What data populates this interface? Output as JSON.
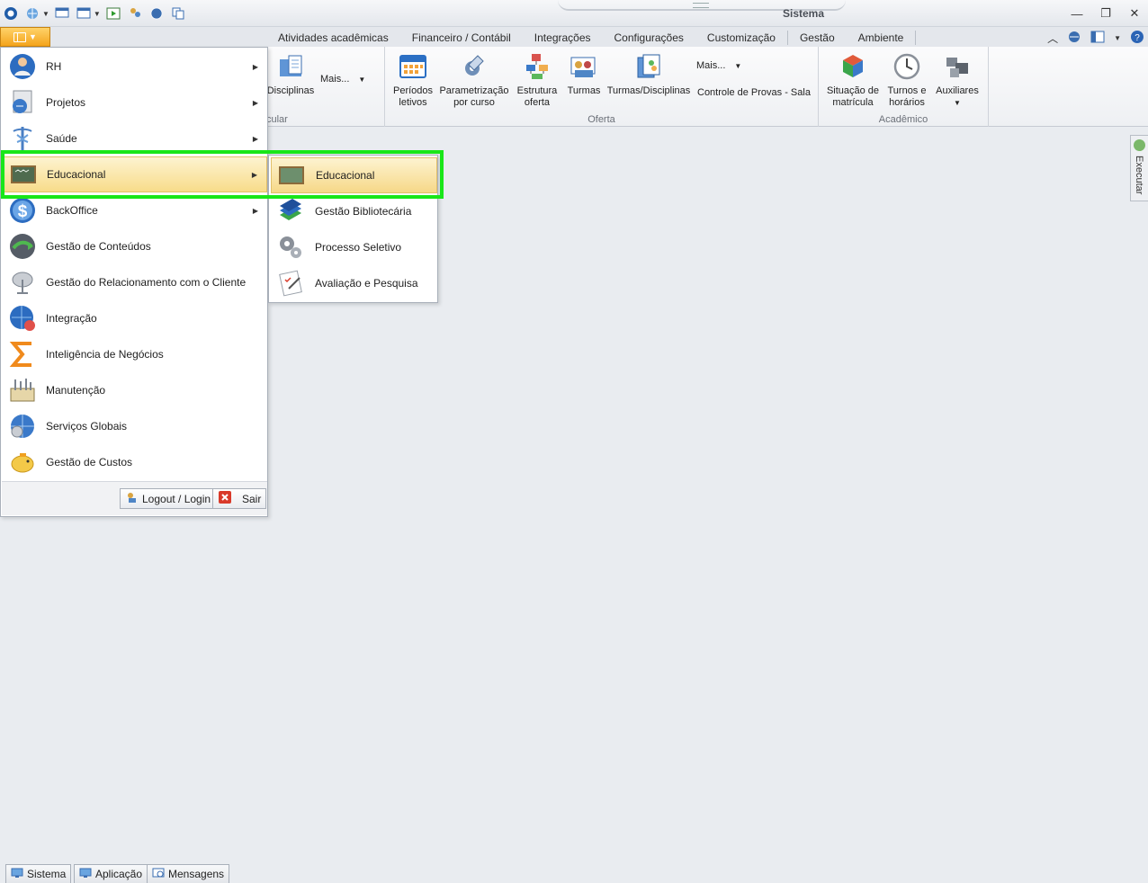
{
  "window": {
    "title": "Sistema"
  },
  "tabs": [
    "Atividades acadêmicas",
    "Financeiro / Contábil",
    "Integrações",
    "Configurações",
    "Customização",
    "Gestão",
    "Ambiente"
  ],
  "ribbon": {
    "curricular": {
      "label": "cular",
      "disciplinas": "Disciplinas",
      "mais": "Mais..."
    },
    "oferta": {
      "label": "Oferta",
      "buttons": [
        {
          "l1": "Períodos",
          "l2": "letivos"
        },
        {
          "l1": "Parametrização",
          "l2": "por curso"
        },
        {
          "l1": "Estrutura",
          "l2": "oferta"
        },
        {
          "l1": "Turmas",
          "l2": ""
        },
        {
          "l1": "Turmas/Disciplinas",
          "l2": ""
        }
      ],
      "mais": "Mais...",
      "controle": "Controle de Provas - Sala"
    },
    "academico": {
      "label": "Acadêmico",
      "buttons": [
        {
          "l1": "Situação de",
          "l2": "matrícula"
        },
        {
          "l1": "Turnos e",
          "l2": "horários"
        },
        {
          "l1": "Auxiliares",
          "l2": ""
        }
      ]
    }
  },
  "dock": {
    "executar": "Executar"
  },
  "menu": {
    "items": [
      {
        "label": "RH",
        "icon": "person-globe-icon"
      },
      {
        "label": "Projetos",
        "icon": "projects-icon"
      },
      {
        "label": "Saúde",
        "icon": "caduceus-icon"
      },
      {
        "label": "Educacional",
        "icon": "chalkboard-icon"
      },
      {
        "label": "BackOffice",
        "icon": "dollar-coin-icon"
      },
      {
        "label": "Gestão de Conteúdos",
        "icon": "globe-arrow-icon"
      },
      {
        "label": "Gestão do Relacionamento com o Cliente",
        "icon": "satellite-dish-icon"
      },
      {
        "label": "Integração",
        "icon": "globe-plug-icon"
      },
      {
        "label": "Inteligência de Negócios",
        "icon": "sigma-icon"
      },
      {
        "label": "Manutenção",
        "icon": "toolbox-icon"
      },
      {
        "label": "Serviços Globais",
        "icon": "globe-gear-icon"
      },
      {
        "label": "Gestão de Custos",
        "icon": "piggy-bank-icon"
      }
    ],
    "logout": "Logout / Login",
    "sair": "Sair"
  },
  "submenu": {
    "items": [
      {
        "label": "Educacional",
        "icon": "chalkboard-icon"
      },
      {
        "label": "Gestão Bibliotecária",
        "icon": "books-icon"
      },
      {
        "label": "Processo Seletivo",
        "icon": "gears-icon"
      },
      {
        "label": "Avaliação e Pesquisa",
        "icon": "checklist-pen-icon"
      }
    ]
  },
  "taskbar": [
    "Sistema",
    "Aplicação",
    "Mensagens"
  ],
  "colors": {
    "highlight": "#19e619",
    "app_button": "#f4a41c",
    "active_item": "#f8dc8a"
  }
}
